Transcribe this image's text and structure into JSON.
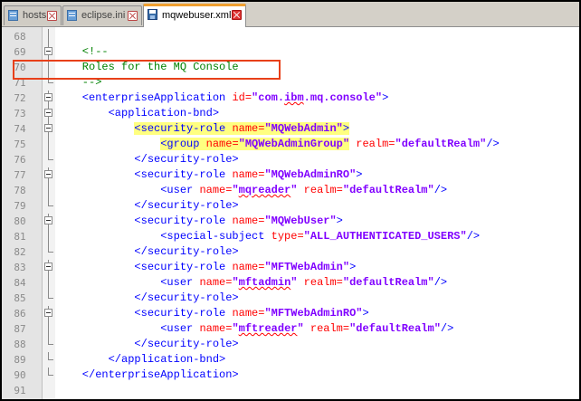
{
  "tabs": [
    {
      "label": "hosts",
      "active": false
    },
    {
      "label": "eclipse.ini",
      "active": false
    },
    {
      "label": "mqwebuser.xml",
      "active": true
    }
  ],
  "lines": [
    {
      "n": "68",
      "fold": "line",
      "parts": []
    },
    {
      "n": "69",
      "fold": "box",
      "parts": [
        {
          "t": "    <!--",
          "c": "cm"
        }
      ]
    },
    {
      "n": "70",
      "fold": "line",
      "parts": [
        {
          "t": "    Roles for the MQ Console",
          "c": "cm"
        }
      ]
    },
    {
      "n": "71",
      "fold": "end",
      "parts": [
        {
          "t": "    -->",
          "c": "cm"
        }
      ]
    },
    {
      "n": "72",
      "fold": "box",
      "parts": [
        {
          "t": "    <enterpriseApplication ",
          "c": "tg"
        },
        {
          "t": "id=",
          "c": "an"
        },
        {
          "t": "\"com.ibm.mq.console\"",
          "c": "av",
          "sq": "ibm"
        },
        {
          "t": ">",
          "c": "tg"
        }
      ]
    },
    {
      "n": "73",
      "fold": "box",
      "parts": [
        {
          "t": "        <application-bnd>",
          "c": "tg"
        }
      ]
    },
    {
      "n": "74",
      "fold": "box",
      "parts": [
        {
          "t": "            ",
          "c": "tg"
        },
        {
          "t": "<security-role ",
          "c": "tg",
          "hl": true
        },
        {
          "t": "name=",
          "c": "an",
          "hl": true
        },
        {
          "t": "\"MQWebAdmin\"",
          "c": "av",
          "hl": true
        },
        {
          "t": ">",
          "c": "tg",
          "hl": true
        }
      ]
    },
    {
      "n": "75",
      "fold": "line",
      "parts": [
        {
          "t": "                ",
          "c": "tg"
        },
        {
          "t": "<group ",
          "c": "tg",
          "hl": true
        },
        {
          "t": "name=",
          "c": "an",
          "hl": true
        },
        {
          "t": "\"MQWebAdminGroup\"",
          "c": "av",
          "hl": true
        },
        {
          "t": " realm=",
          "c": "an"
        },
        {
          "t": "\"defaultRealm\"",
          "c": "av"
        },
        {
          "t": "/>",
          "c": "tg"
        }
      ]
    },
    {
      "n": "76",
      "fold": "end",
      "parts": [
        {
          "t": "            </security-role>",
          "c": "tg"
        }
      ]
    },
    {
      "n": "77",
      "fold": "box",
      "parts": [
        {
          "t": "            <security-role ",
          "c": "tg"
        },
        {
          "t": "name=",
          "c": "an"
        },
        {
          "t": "\"MQWebAdminRO\"",
          "c": "av"
        },
        {
          "t": ">",
          "c": "tg"
        }
      ]
    },
    {
      "n": "78",
      "fold": "line",
      "parts": [
        {
          "t": "                <user ",
          "c": "tg"
        },
        {
          "t": "name=",
          "c": "an"
        },
        {
          "t": "\"mqreader\"",
          "c": "av",
          "sq": "mqreader"
        },
        {
          "t": " realm=",
          "c": "an"
        },
        {
          "t": "\"defaultRealm\"",
          "c": "av"
        },
        {
          "t": "/>",
          "c": "tg"
        }
      ]
    },
    {
      "n": "79",
      "fold": "end",
      "parts": [
        {
          "t": "            </security-role>",
          "c": "tg"
        }
      ]
    },
    {
      "n": "80",
      "fold": "box",
      "parts": [
        {
          "t": "            <security-role ",
          "c": "tg"
        },
        {
          "t": "name=",
          "c": "an"
        },
        {
          "t": "\"MQWebUser\"",
          "c": "av"
        },
        {
          "t": ">",
          "c": "tg"
        }
      ]
    },
    {
      "n": "81",
      "fold": "line",
      "parts": [
        {
          "t": "                <special-subject ",
          "c": "tg"
        },
        {
          "t": "type=",
          "c": "an"
        },
        {
          "t": "\"ALL_AUTHENTICATED_USERS\"",
          "c": "av"
        },
        {
          "t": "/>",
          "c": "tg"
        }
      ]
    },
    {
      "n": "82",
      "fold": "end",
      "parts": [
        {
          "t": "            </security-role>",
          "c": "tg"
        }
      ]
    },
    {
      "n": "83",
      "fold": "box",
      "parts": [
        {
          "t": "            <security-role ",
          "c": "tg"
        },
        {
          "t": "name=",
          "c": "an"
        },
        {
          "t": "\"MFTWebAdmin\"",
          "c": "av"
        },
        {
          "t": ">",
          "c": "tg"
        }
      ]
    },
    {
      "n": "84",
      "fold": "line",
      "parts": [
        {
          "t": "                <user ",
          "c": "tg"
        },
        {
          "t": "name=",
          "c": "an"
        },
        {
          "t": "\"mftadmin\"",
          "c": "av",
          "sq": "mftadmin"
        },
        {
          "t": " realm=",
          "c": "an"
        },
        {
          "t": "\"defaultRealm\"",
          "c": "av"
        },
        {
          "t": "/>",
          "c": "tg"
        }
      ]
    },
    {
      "n": "85",
      "fold": "end",
      "parts": [
        {
          "t": "            </security-role>",
          "c": "tg"
        }
      ]
    },
    {
      "n": "86",
      "fold": "box",
      "parts": [
        {
          "t": "            <security-role ",
          "c": "tg"
        },
        {
          "t": "name=",
          "c": "an"
        },
        {
          "t": "\"MFTWebAdminRO\"",
          "c": "av"
        },
        {
          "t": ">",
          "c": "tg"
        }
      ]
    },
    {
      "n": "87",
      "fold": "line",
      "parts": [
        {
          "t": "                <user ",
          "c": "tg"
        },
        {
          "t": "name=",
          "c": "an"
        },
        {
          "t": "\"mftreader\"",
          "c": "av",
          "sq": "mftreader"
        },
        {
          "t": " realm=",
          "c": "an"
        },
        {
          "t": "\"defaultRealm\"",
          "c": "av"
        },
        {
          "t": "/>",
          "c": "tg"
        }
      ]
    },
    {
      "n": "88",
      "fold": "end",
      "parts": [
        {
          "t": "            </security-role>",
          "c": "tg"
        }
      ]
    },
    {
      "n": "89",
      "fold": "end",
      "parts": [
        {
          "t": "        </application-bnd>",
          "c": "tg"
        }
      ]
    },
    {
      "n": "90",
      "fold": "end",
      "parts": [
        {
          "t": "    </enterpriseApplication>",
          "c": "tg"
        }
      ]
    },
    {
      "n": "91",
      "fold": "none",
      "parts": []
    }
  ],
  "colors": {
    "comment": "#008000",
    "tag": "#0000ff",
    "attr_name": "#ff0000",
    "attr_value": "#8000ff",
    "highlight": "#ffff80",
    "annotation_box": "#e8401a"
  }
}
